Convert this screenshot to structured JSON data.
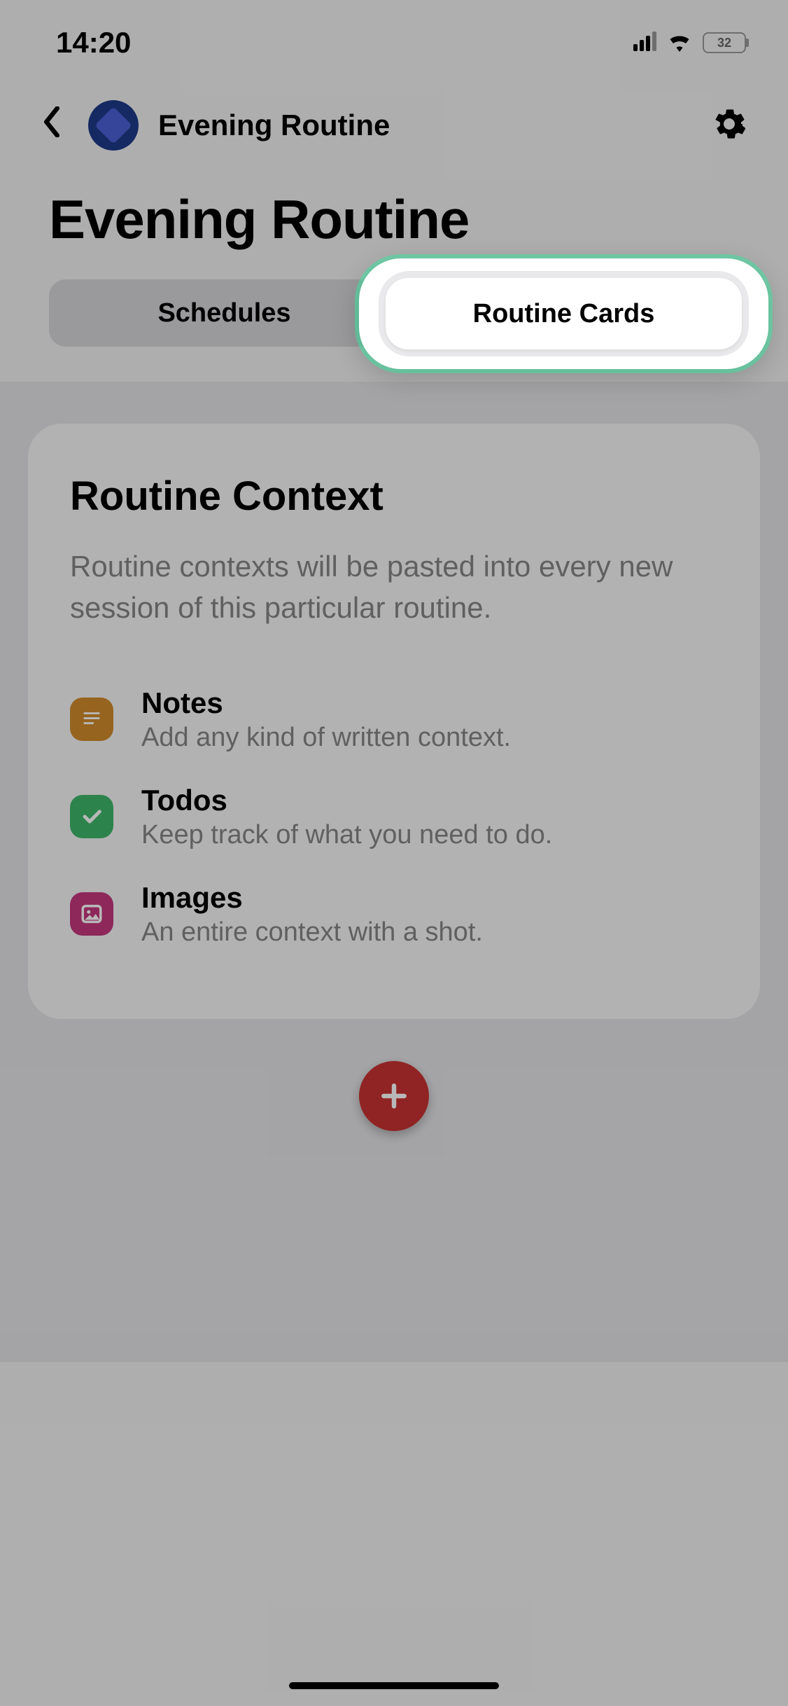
{
  "status": {
    "time": "14:20",
    "battery": "32"
  },
  "nav": {
    "title": "Evening Routine"
  },
  "page": {
    "title": "Evening Routine"
  },
  "tabs": {
    "schedules": "Schedules",
    "routine_cards": "Routine Cards"
  },
  "card": {
    "title": "Routine Context",
    "desc": "Routine contexts will be pasted into every new session of this particular routine.",
    "items": [
      {
        "title": "Notes",
        "desc": "Add any kind of written context."
      },
      {
        "title": "Todos",
        "desc": "Keep track of what you need to do."
      },
      {
        "title": "Images",
        "desc": "An entire context with a shot."
      }
    ]
  }
}
